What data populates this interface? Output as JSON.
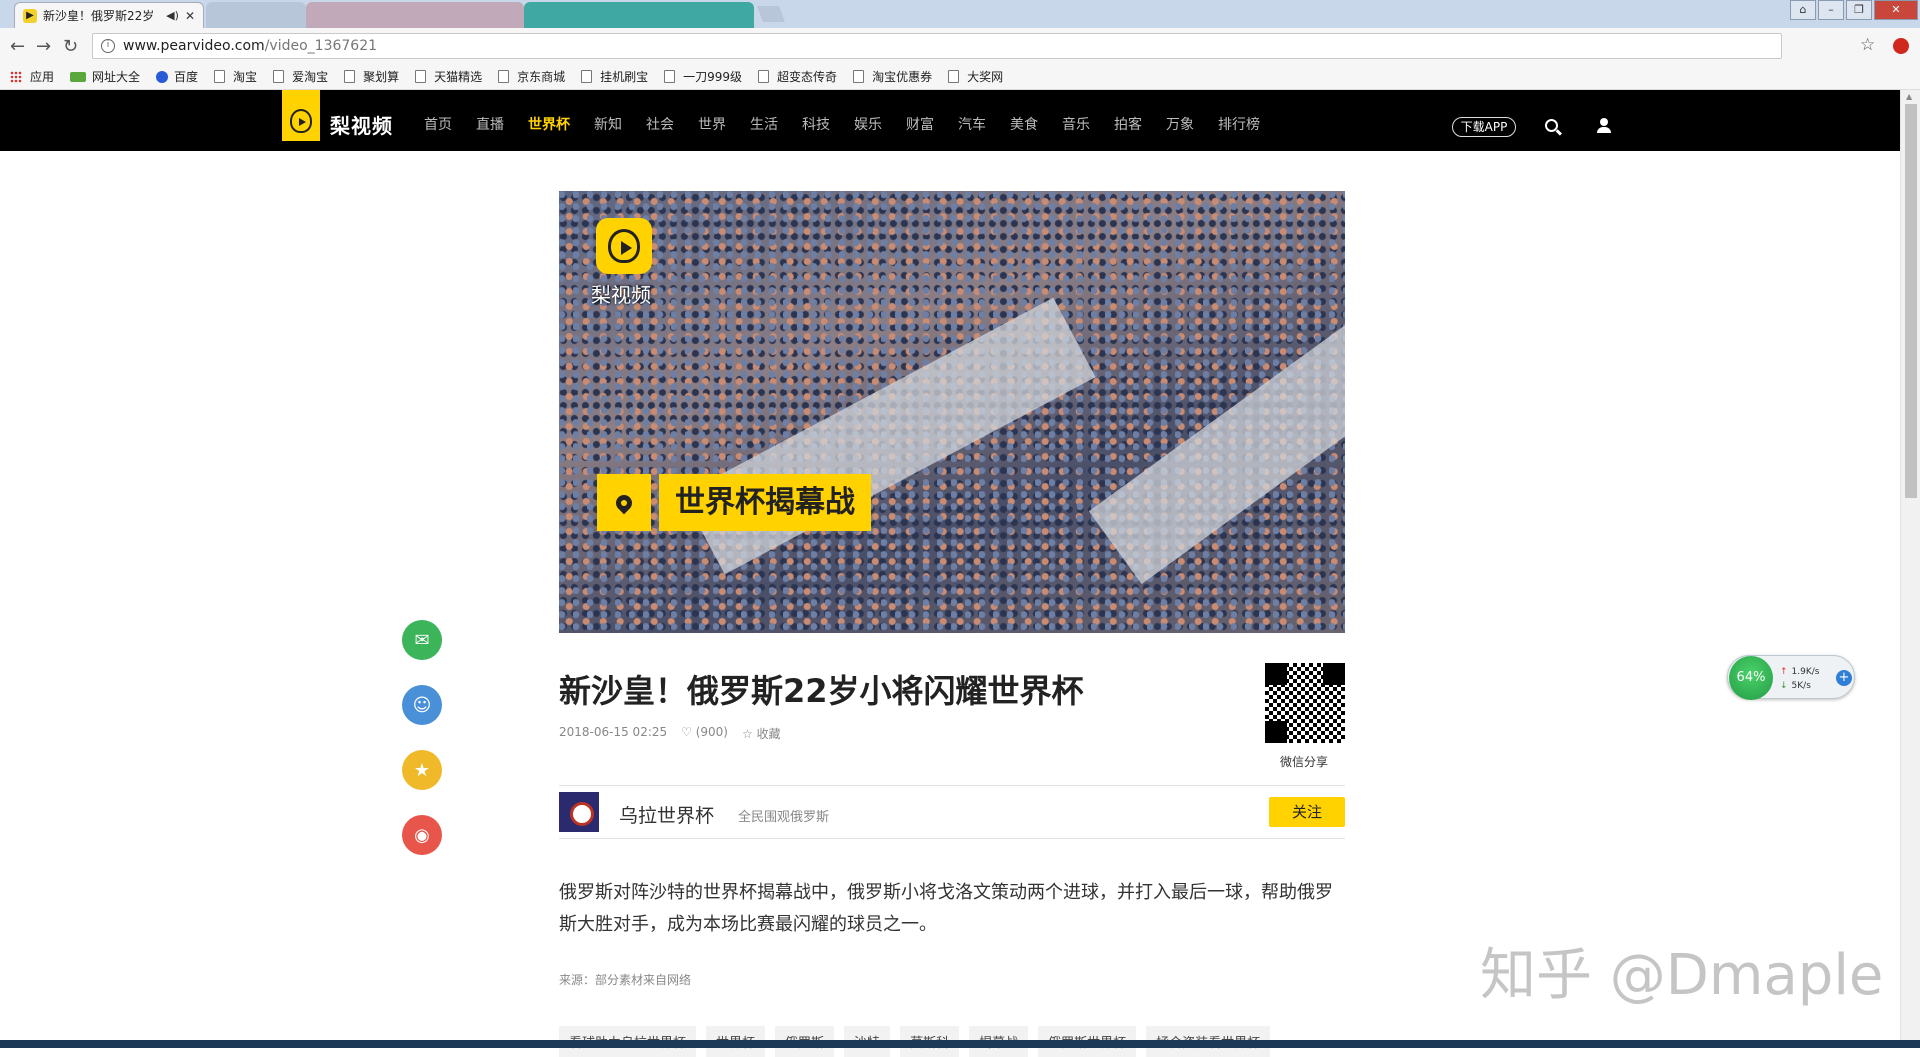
{
  "browser": {
    "tabs": [
      {
        "title": "新沙皇！俄罗斯22岁",
        "active": true
      },
      {
        "title": "",
        "active": false
      },
      {
        "title": "",
        "active": false
      },
      {
        "title": "",
        "active": false
      }
    ],
    "url_host": "www.pearvideo.com",
    "url_path": "/video_1367621",
    "bookmarks": [
      {
        "label": "应用",
        "icon": "apps-grid-icon"
      },
      {
        "label": "网址大全",
        "icon": "hao123-icon"
      },
      {
        "label": "百度",
        "icon": "baidu-paw-icon"
      },
      {
        "label": "淘宝",
        "icon": "page-icon"
      },
      {
        "label": "爱淘宝",
        "icon": "page-icon"
      },
      {
        "label": "聚划算",
        "icon": "page-icon"
      },
      {
        "label": "天猫精选",
        "icon": "page-icon"
      },
      {
        "label": "京东商城",
        "icon": "page-icon"
      },
      {
        "label": "挂机刷宝",
        "icon": "page-icon"
      },
      {
        "label": "一刀999级",
        "icon": "page-icon"
      },
      {
        "label": "超变态传奇",
        "icon": "page-icon"
      },
      {
        "label": "淘宝优惠券",
        "icon": "page-icon"
      },
      {
        "label": "大奖网",
        "icon": "page-icon"
      }
    ]
  },
  "site": {
    "logo_text": "梨视频",
    "nav": [
      "首页",
      "直播",
      "世界杯",
      "新知",
      "社会",
      "世界",
      "生活",
      "科技",
      "娱乐",
      "财富",
      "汽车",
      "美食",
      "音乐",
      "拍客",
      "万象",
      "排行榜"
    ],
    "nav_active": "世界杯",
    "download_label": "下载APP",
    "brand_color": "#ffd200"
  },
  "video": {
    "logo_text": "梨视频",
    "overlay_title": "世界杯揭幕战"
  },
  "article": {
    "title": "新沙皇！俄罗斯22岁小将闪耀世界杯",
    "date": "2018-06-15 02:25",
    "likes": "(900)",
    "favorite_label": "收藏",
    "qr_label": "微信分享",
    "author_name": "乌拉世界杯",
    "author_desc": "全民围观俄罗斯",
    "follow_label": "关注",
    "summary": "俄罗斯对阵沙特的世界杯揭幕战中，俄罗斯小将戈洛文策动两个进球，并打入最后一球，帮助俄罗斯大胜对手，成为本场比赛最闪耀的球员之一。",
    "source": "来源：部分素材来自网络",
    "tags": [
      "看球助力乌拉世界杯",
      "世界杯",
      "俄罗斯",
      "沙特",
      "莫斯科",
      "揭幕战",
      "俄罗斯世界杯",
      "拯合资装看世界杯"
    ]
  },
  "share": [
    {
      "name": "wechat-share-button",
      "color": "#3cb45a"
    },
    {
      "name": "qq-share-button",
      "color": "#4a90d9"
    },
    {
      "name": "qzone-share-button",
      "color": "#f0b92a"
    },
    {
      "name": "weibo-share-button",
      "color": "#e8564b"
    }
  ],
  "net_widget": {
    "percent": "64%",
    "up_rate": "1.9K/s",
    "down_rate": "5K/s"
  },
  "watermark": "知乎 @Dmaple"
}
